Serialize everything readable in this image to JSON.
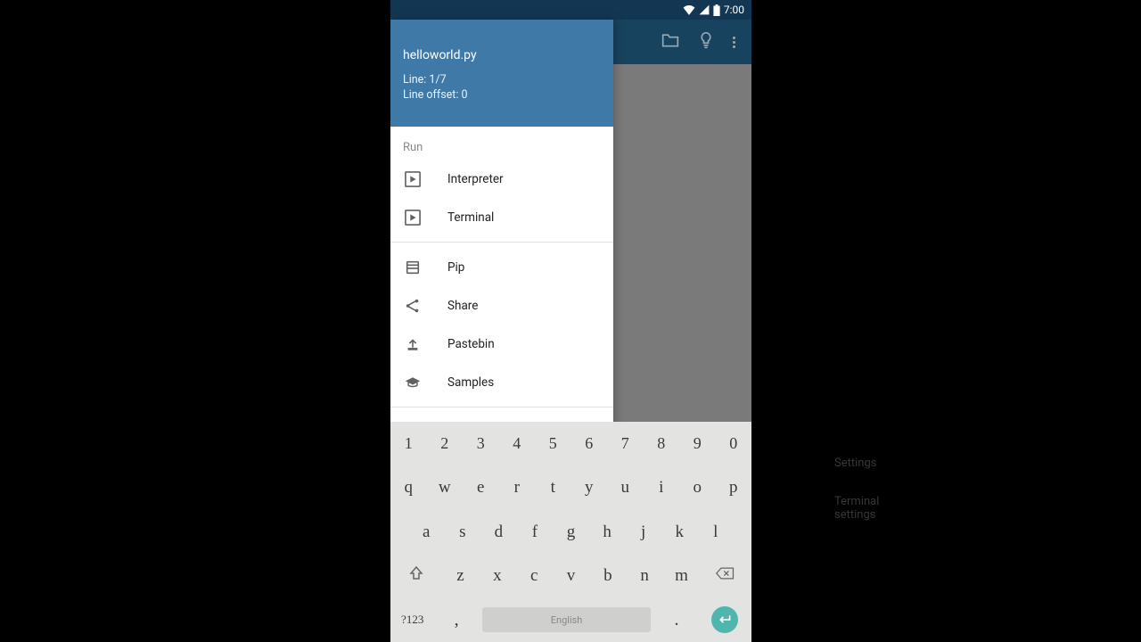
{
  "statusbar": {
    "time": "7:00"
  },
  "drawer": {
    "filename": "helloworld.py",
    "line_info": "Line: 1/7",
    "offset_info": "Line offset: 0",
    "section_run": "Run",
    "items_run": [
      {
        "label": "Interpreter",
        "icon": "play-box"
      },
      {
        "label": "Terminal",
        "icon": "play-box"
      }
    ],
    "items_more": [
      {
        "label": "Pip",
        "icon": "library"
      },
      {
        "label": "Share",
        "icon": "share"
      },
      {
        "label": "Pastebin",
        "icon": "upload"
      },
      {
        "label": "Samples",
        "icon": "school"
      }
    ],
    "ghost_settings": "Settings",
    "ghost_terminal_settings": "Terminal settings"
  },
  "keyboard": {
    "row1": [
      "1",
      "2",
      "3",
      "4",
      "5",
      "6",
      "7",
      "8",
      "9",
      "0"
    ],
    "row2": [
      "q",
      "w",
      "e",
      "r",
      "t",
      "y",
      "u",
      "i",
      "o",
      "p"
    ],
    "row3": [
      "a",
      "s",
      "d",
      "f",
      "g",
      "h",
      "j",
      "k",
      "l"
    ],
    "row4": [
      "z",
      "x",
      "c",
      "v",
      "b",
      "n",
      "m"
    ],
    "sym": "?123",
    "lang": "English",
    "comma": ",",
    "period": "."
  }
}
